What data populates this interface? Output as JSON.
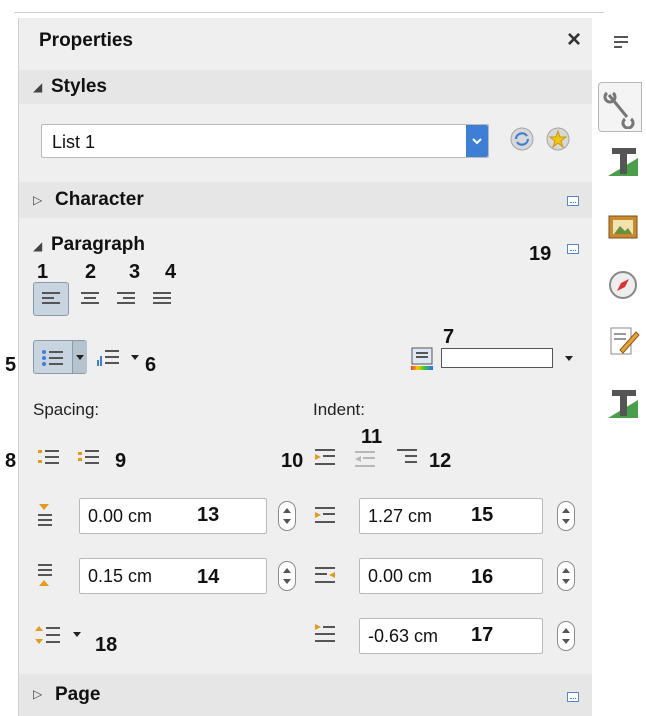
{
  "panel": {
    "title": "Properties",
    "close_glyph": "×"
  },
  "styles": {
    "header": "Styles",
    "selected_style": "List 1",
    "dropdown_icon": "chevron-down-icon",
    "update_icon": "update-style-icon",
    "new_icon": "new-style-icon"
  },
  "character": {
    "header": "Character"
  },
  "paragraph": {
    "header": "Paragraph",
    "spacing_label": "Spacing:",
    "indent_label": "Indent:",
    "above_spacing": "0.00 cm",
    "below_spacing": "0.15 cm",
    "before_indent": "1.27 cm",
    "after_indent": "0.00 cm",
    "first_line_indent": "-0.63 cm"
  },
  "page": {
    "header": "Page"
  },
  "callouts": [
    "1",
    "2",
    "3",
    "4",
    "5",
    "6",
    "7",
    "8",
    "9",
    "10",
    "11",
    "12",
    "13",
    "14",
    "15",
    "16",
    "17",
    "18",
    "19"
  ],
  "colors": {
    "panel_bg": "#efefef",
    "header_bg": "#e6e6e6",
    "accent": "#3d7fd6",
    "active_button": "#c8d4df"
  },
  "sidebar_tabs": [
    "properties-icon",
    "styles-icon",
    "gallery-icon",
    "navigator-icon",
    "manage-changes-icon",
    "page-styles-icon"
  ]
}
